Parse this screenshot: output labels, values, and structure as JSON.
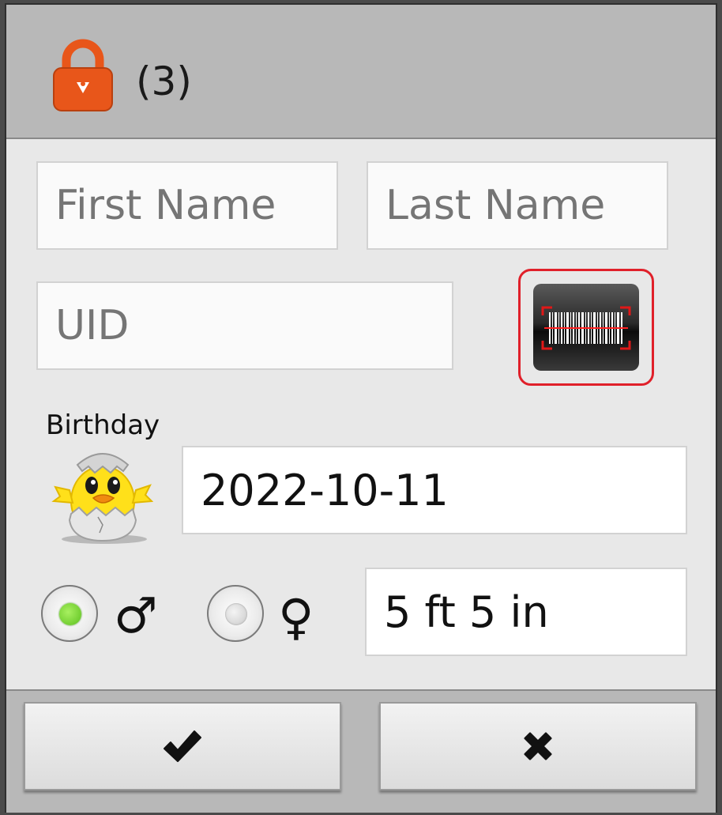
{
  "header": {
    "count_label": "(3)",
    "lock_icon": "lock-person-icon",
    "lock_color": "#e8561a"
  },
  "form": {
    "first_name": {
      "placeholder": "First Name",
      "value": ""
    },
    "last_name": {
      "placeholder": "Last Name",
      "value": ""
    },
    "uid": {
      "placeholder": "UID",
      "value": ""
    },
    "barcode_button_icon": "barcode-scan-icon",
    "birthday_label": "Birthday",
    "birthday_icon": "hatching-chick-icon",
    "birthday_value": "2022-10-11",
    "gender": {
      "selected": "male",
      "male_symbol": "♂",
      "female_symbol": "♀",
      "selected_color": "#6fd12e"
    },
    "height_value": "5 ft 5 in"
  },
  "footer": {
    "confirm_icon": "checkmark-icon",
    "cancel_icon": "x-icon"
  }
}
